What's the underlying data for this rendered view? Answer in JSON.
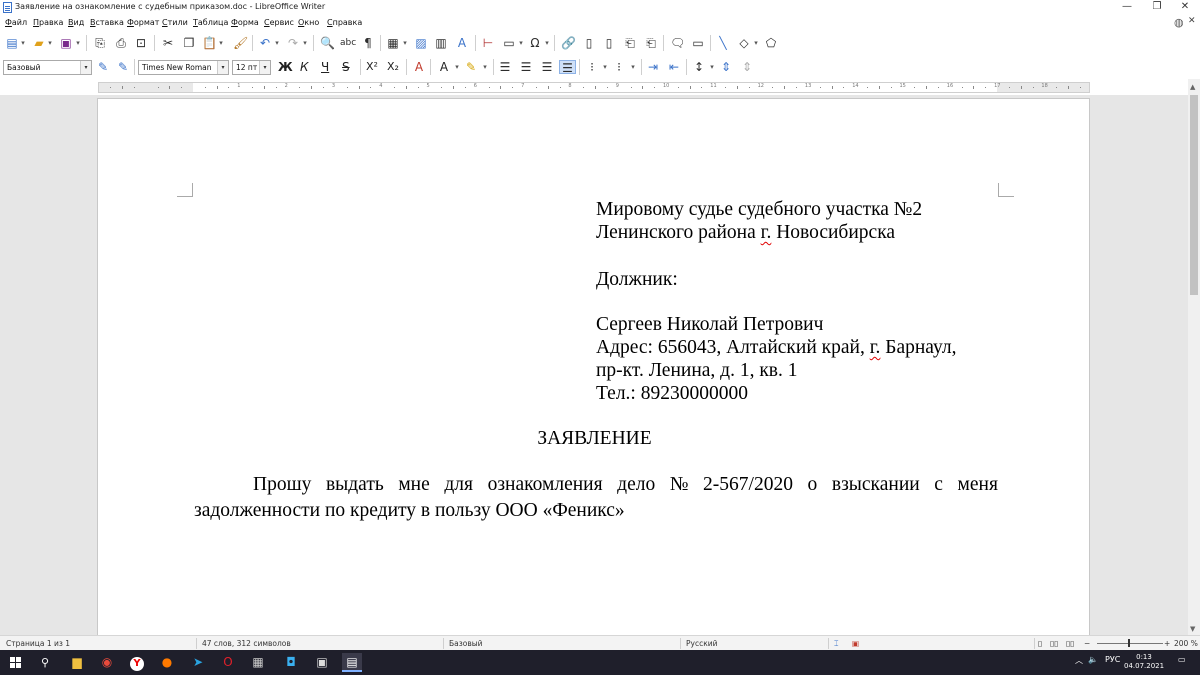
{
  "window": {
    "title": "Заявление на ознакомление с судебным приказом.doc - LibreOffice Writer",
    "controls": {
      "minimize": "—",
      "restore": "❐",
      "close": "✕"
    }
  },
  "menu": [
    "Файл",
    "Правка",
    "Вид",
    "Вставка",
    "Формат",
    "Стили",
    "Таблица",
    "Форма",
    "Сервис",
    "Окно",
    "Справка"
  ],
  "formatting": {
    "style": "Базовый",
    "font": "Times New Roman",
    "size": "12 пт",
    "bold": "Ж",
    "italic": "К",
    "underline": "Ч",
    "strike": "S",
    "superscript": "X²",
    "subscript": "X₂"
  },
  "ruler": {
    "numbers": [
      "1",
      "2",
      "3",
      "4",
      "5",
      "6",
      "7",
      "8",
      "9",
      "10",
      "11",
      "12",
      "13",
      "14",
      "15",
      "16",
      "17",
      "18"
    ]
  },
  "document": {
    "addressee": [
      "Мировому судье судебного участка №2",
      "Ленинского района г. Новосибирска"
    ],
    "debtor_label": "Должник:",
    "debtor": {
      "name": "Сергеев Николай Петрович",
      "address1": "Адрес: 656043, Алтайский край, г. Барнаул,",
      "address2": "пр-кт. Ленина, д. 1, кв. 1",
      "phone": "Тел.: 89230000000"
    },
    "heading": "ЗАЯВЛЕНИЕ",
    "body_line1_words": [
      "Прошу",
      "выдать",
      "мне",
      "для",
      "ознакомления",
      "дело",
      "№",
      "2-567/2020",
      "о",
      "взыскании",
      "с",
      "меня"
    ],
    "body_line2": "задолженности по кредиту в пользу ООО «Феникс»"
  },
  "status": {
    "page": "Страница 1 из 1",
    "words": "47 слов, 312 символов",
    "style": "Базовый",
    "language": "Русский",
    "zoom": "200 %"
  },
  "taskbar": {
    "lang": "РУС",
    "time": "0:13",
    "date": "04.07.2021"
  },
  "colors": {
    "accent": "#3a72c9",
    "taskbar": "#1f1f2b",
    "spell": "#e00000"
  }
}
